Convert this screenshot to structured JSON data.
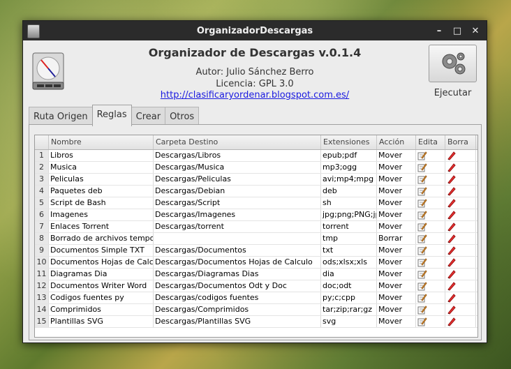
{
  "window": {
    "title": "OrganizadorDescargas"
  },
  "header": {
    "app_title": "Organizador de Descargas v.0.1.4",
    "author": "Autor: Julio Sánchez Berro",
    "license": "Licencia: GPL 3.0",
    "link": "http://clasificaryordenar.blogspot.com.es/",
    "exec_label": "Ejecutar"
  },
  "tabs": [
    {
      "label": "Ruta Origen"
    },
    {
      "label": "Reglas"
    },
    {
      "label": "Crear"
    },
    {
      "label": "Otros"
    }
  ],
  "table": {
    "headers": [
      "",
      "Nombre",
      "Carpeta Destino",
      "Extensiones",
      "Acción",
      "Edita",
      "Borra"
    ],
    "rows": [
      {
        "n": "1",
        "name": "Libros",
        "dest": "Descargas/Libros",
        "ext": "epub;pdf",
        "action": "Mover"
      },
      {
        "n": "2",
        "name": "Musica",
        "dest": "Descargas/Musica",
        "ext": "mp3;ogg",
        "action": "Mover"
      },
      {
        "n": "3",
        "name": "Peliculas",
        "dest": "Descargas/Peliculas",
        "ext": "avi;mp4;mpg",
        "action": "Mover"
      },
      {
        "n": "4",
        "name": "Paquetes deb",
        "dest": "Descargas/Debian",
        "ext": "deb",
        "action": "Mover"
      },
      {
        "n": "5",
        "name": "Script de Bash",
        "dest": "Descargas/Script",
        "ext": "sh",
        "action": "Mover"
      },
      {
        "n": "6",
        "name": "Imagenes",
        "dest": "Descargas/Imagenes",
        "ext": "jpg;png;PNG;jp",
        "action": "Mover"
      },
      {
        "n": "7",
        "name": "Enlaces Torrent",
        "dest": "Descargas/torrent",
        "ext": "torrent",
        "action": "Mover"
      },
      {
        "n": "8",
        "name": "Borrado de archivos tempor",
        "dest": "",
        "ext": "tmp",
        "action": "Borrar"
      },
      {
        "n": "9",
        "name": "Documentos Simple TXT",
        "dest": "Descargas/Documentos",
        "ext": "txt",
        "action": "Mover"
      },
      {
        "n": "10",
        "name": "Documentos Hojas de Calcu",
        "dest": "Descargas/Documentos Hojas de Calculo",
        "ext": "ods;xlsx;xls",
        "action": "Mover"
      },
      {
        "n": "11",
        "name": "Diagramas Dia",
        "dest": "Descargas/Diagramas Dias",
        "ext": "dia",
        "action": "Mover"
      },
      {
        "n": "12",
        "name": "Documentos Writer Word",
        "dest": "Descargas/Documentos Odt y Doc",
        "ext": "doc;odt",
        "action": "Mover"
      },
      {
        "n": "13",
        "name": "Codigos fuentes py",
        "dest": "Descargas/codigos fuentes",
        "ext": "py;c;cpp",
        "action": "Mover"
      },
      {
        "n": "14",
        "name": "Comprimidos",
        "dest": "Descargas/Comprimidos",
        "ext": "tar;zip;rar;gz",
        "action": "Mover"
      },
      {
        "n": "15",
        "name": "Plantillas SVG",
        "dest": "Descargas/Plantillas SVG",
        "ext": "svg",
        "action": "Mover"
      }
    ]
  },
  "icons": {
    "edit": "edit-icon",
    "delete": "delete-icon",
    "gears": "gears-icon"
  }
}
